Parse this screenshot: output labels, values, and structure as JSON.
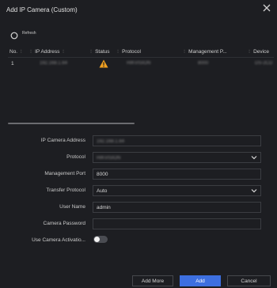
{
  "dialog": {
    "title": "Add IP Camera (Custom)",
    "refresh_label": "Refresh"
  },
  "table": {
    "columns": [
      "No.",
      "IP Address",
      "Status",
      "Protocol",
      "Management P...",
      "Device"
    ],
    "rows": [
      {
        "no": "1",
        "ip_address": "192.168.1.64",
        "status_icon": "warning-icon",
        "protocol": "HIKVISION",
        "management_port": "8000",
        "device": "DS-2CD"
      }
    ]
  },
  "form": {
    "ip_camera_address": {
      "label": "IP Camera Address",
      "value": "192.168.1.64"
    },
    "protocol": {
      "label": "Protocol",
      "value": "HIKVISION"
    },
    "management_port": {
      "label": "Management Port",
      "value": "8000"
    },
    "transfer_protocol": {
      "label": "Transfer Protocol",
      "value": "Auto"
    },
    "user_name": {
      "label": "User Name",
      "value": "admin"
    },
    "camera_password": {
      "label": "Camera Password",
      "value": ""
    },
    "use_camera_activation": {
      "label": "Use Camera Activatio...",
      "enabled": false
    }
  },
  "buttons": {
    "add_more": "Add More",
    "add": "Add",
    "cancel": "Cancel"
  },
  "colors": {
    "background": "#1d1e22",
    "accent": "#3d6fe0",
    "warning": "#f0a020"
  }
}
